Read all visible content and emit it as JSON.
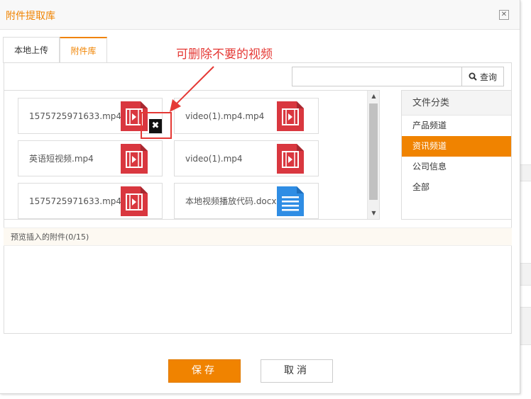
{
  "dialog": {
    "title": "附件提取库",
    "close_icon": "close-icon"
  },
  "tabs": [
    {
      "label": "本地上传",
      "active": false
    },
    {
      "label": "附件库",
      "active": true
    }
  ],
  "annotation": {
    "text": "可删除不要的视频",
    "color": "#e53935"
  },
  "search": {
    "value": "",
    "placeholder": "",
    "button_label": "查询",
    "icon": "search-icon"
  },
  "files": [
    {
      "name": "1575725971633.mp4",
      "type": "video",
      "icon": "video-file-icon"
    },
    {
      "name": "video(1).mp4.mp4",
      "type": "video",
      "icon": "video-file-icon"
    },
    {
      "name": "英语短视频.mp4",
      "type": "video",
      "icon": "video-file-icon"
    },
    {
      "name": "video(1).mp4",
      "type": "video",
      "icon": "video-file-icon"
    },
    {
      "name": "1575725971633.mp4",
      "type": "video",
      "icon": "video-file-icon"
    },
    {
      "name": "本地视频播放代码.docx",
      "type": "document",
      "icon": "document-file-icon"
    }
  ],
  "categories": {
    "header": "文件分类",
    "items": [
      {
        "label": "产品频道",
        "active": false
      },
      {
        "label": "资讯频道",
        "active": true
      },
      {
        "label": "公司信息",
        "active": false
      },
      {
        "label": "全部",
        "active": false
      }
    ]
  },
  "preview": {
    "label": "预览插入的附件(0/15)"
  },
  "footer": {
    "save_label": "保存",
    "cancel_label": "取消"
  },
  "colors": {
    "accent": "#f08300",
    "video_icon": "#d9373f",
    "doc_icon": "#2f8de4",
    "annotation_red": "#e53935"
  }
}
